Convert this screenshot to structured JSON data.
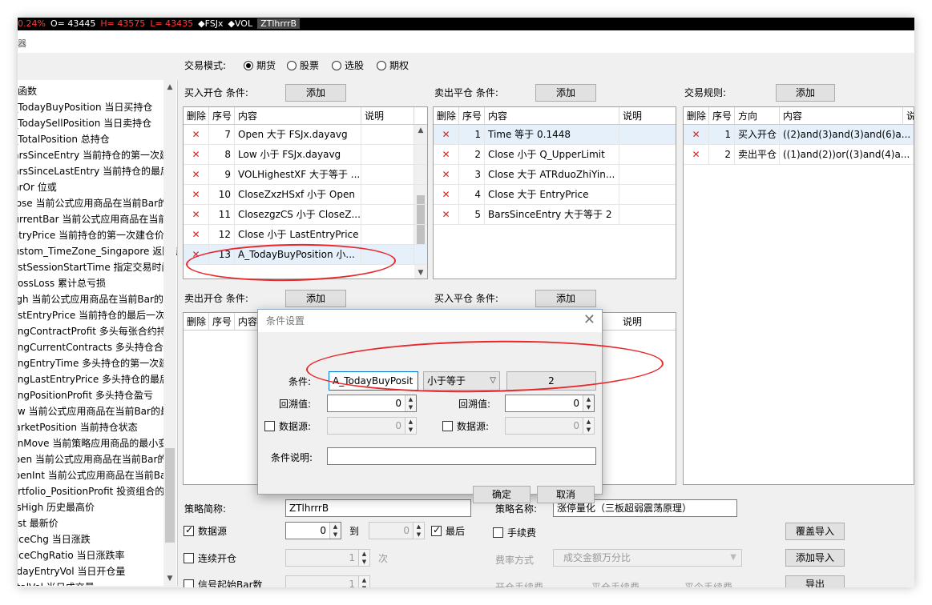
{
  "ticker": [
    {
      "text": "0.24%",
      "color": "red"
    },
    {
      "text": "O= 43445",
      "color": "white"
    },
    {
      "text": "H= 43575",
      "color": "red"
    },
    {
      "text": "L= 43435",
      "color": "red"
    },
    {
      "text": "◆FSJx",
      "color": "white"
    },
    {
      "text": "◆VOL",
      "color": "white"
    },
    {
      "text": "ZTlhrrrB",
      "color": "active"
    }
  ],
  "window_stub": "器",
  "trade_mode": {
    "label": "交易模式:",
    "options": [
      "期货",
      "股票",
      "选股",
      "期权"
    ],
    "selected": "期货"
  },
  "left_tree": {
    "items": [
      "函数",
      "A_TodayBuyPosition 当日买持仓",
      "A_TodaySellPosition 当日卖持仓",
      "A_TotalPosition 总持仓",
      "BarsSinceEntry 当前持仓的第一次建",
      "BarsSinceLastEntry 当前持仓的最后",
      "BarOr 位或",
      "Close 当前公式应用商品在当前Bar的",
      "CurrentBar 当前公式应用商品在当前",
      "EntryPrice 当前持仓的第一次建仓价格",
      "Custom_TimeZone_Singapore 返回新",
      "FirstSessionStartTime 指定交易时间",
      "GrossLoss 累计总亏损",
      "High 当前公式应用商品在当前Bar的",
      "LastEntryPrice 当前持仓的最后一次建",
      "LongContractProfit 多头每张合约持",
      "LongCurrentContracts 多头持仓合约",
      "LongEntryTime 多头持仓的第一次建",
      "LongLastEntryPrice 多头持仓的最后",
      "LongPositionProfit 多头持仓盈亏",
      "Low 当前公式应用商品在当前Bar的最",
      "MarketPosition 当前持仓状态",
      "MinMove 当前策略应用商品的最小变",
      "Open 当前公式应用商品在当前Bar的",
      "OpenInt 当前公式应用商品在当前Ba",
      "Portfolio_PositionProfit 投资组合的",
      "HisHigh 历史最高价",
      "Last 最新价",
      "PriceChg 当日涨跌",
      "PriceChgRatio 当日涨跌率",
      "TodayEntryVol 当日开仓量",
      "TotalVol 当日成交量"
    ]
  },
  "buy_open": {
    "label": "买入开仓 条件:",
    "add_label": "添加",
    "headers": [
      "删除",
      "序号",
      "内容",
      "说明"
    ],
    "rows": [
      {
        "no": "7",
        "content": "Open 大于 FSJx.dayavg",
        "note": ""
      },
      {
        "no": "8",
        "content": "Low 小于 FSJx.dayavg",
        "note": ""
      },
      {
        "no": "9",
        "content": "VOLHighestXF 大于等于 ...",
        "note": ""
      },
      {
        "no": "10",
        "content": "CloseZxzHSxf 小于 Open",
        "note": ""
      },
      {
        "no": "11",
        "content": "ClosezgzCS 小于 CloseZ...",
        "note": ""
      },
      {
        "no": "12",
        "content": "Close 小于 LastEntryPrice",
        "note": ""
      },
      {
        "no": "13",
        "content": "A_TodayBuyPosition 小...",
        "note": ""
      }
    ]
  },
  "sell_close": {
    "label": "卖出平仓 条件:",
    "add_label": "添加",
    "headers": [
      "删除",
      "序号",
      "内容",
      "说明"
    ],
    "rows": [
      {
        "no": "1",
        "content": "Time 等于 0.1448",
        "note": ""
      },
      {
        "no": "2",
        "content": "Close 小于 Q_UpperLimit",
        "note": ""
      },
      {
        "no": "3",
        "content": "Close 大于 ATRduoZhiYin...",
        "note": ""
      },
      {
        "no": "4",
        "content": "Close 大于 EntryPrice",
        "note": ""
      },
      {
        "no": "5",
        "content": "BarsSinceEntry 大于等于 2",
        "note": ""
      }
    ]
  },
  "trade_rules": {
    "label": "交易规则:",
    "add_label": "添加",
    "headers": [
      "删除",
      "序号",
      "方向",
      "内容",
      "说"
    ],
    "rows": [
      {
        "no": "1",
        "dir": "买入开仓",
        "content": "((2)and(3)and(3)and(6)a..."
      },
      {
        "no": "2",
        "dir": "卖出平仓",
        "content": "((1)and(2))or((3)and(4)a..."
      }
    ]
  },
  "sell_open": {
    "label": "卖出开仓 条件:",
    "add_label": "添加",
    "headers": [
      "删除",
      "序号",
      "内容"
    ]
  },
  "buy_close": {
    "label": "买入平仓 条件:",
    "add_label": "添加",
    "headers": [
      "说明"
    ]
  },
  "dialog": {
    "title": "条件设置",
    "cond_label": "条件:",
    "cond_left": "A_TodayBuyPosit",
    "cond_op": "小于等于",
    "cond_right": "2",
    "lookback_label": "回溯值:",
    "lookback_left": "0",
    "lookback_right": "0",
    "datasource_label": "数据源:",
    "datasource_left": "0",
    "datasource_right": "0",
    "note_label": "条件说明:",
    "note_value": "",
    "ok": "确定",
    "cancel": "取消"
  },
  "bottom": {
    "strategy_short_label": "策略简称:",
    "strategy_short_value": "ZTlhrrrB",
    "strategy_name_label": "策略名称:",
    "strategy_name_value": "涨停量化（三板超弱震荡原理）",
    "datasource_label": "数据源",
    "ds_from": "0",
    "to_label": "到",
    "ds_to": "0",
    "latest_label": "最后",
    "fee_label": "手续费",
    "cover_import": "覆盖导入",
    "consecutive_label": "连续开仓",
    "consecutive_value": "1",
    "times_label": "次",
    "rate_label": "费率方式",
    "rate_value": "成交金额万分比",
    "add_import": "添加导入",
    "signal_label": "信号起始Bar数",
    "signal_value": "1",
    "open_fee_label": "开仓手续费",
    "close_fee_label": "平仓手续费",
    "close_today_label": "平今手续费",
    "export_label": "导出"
  }
}
